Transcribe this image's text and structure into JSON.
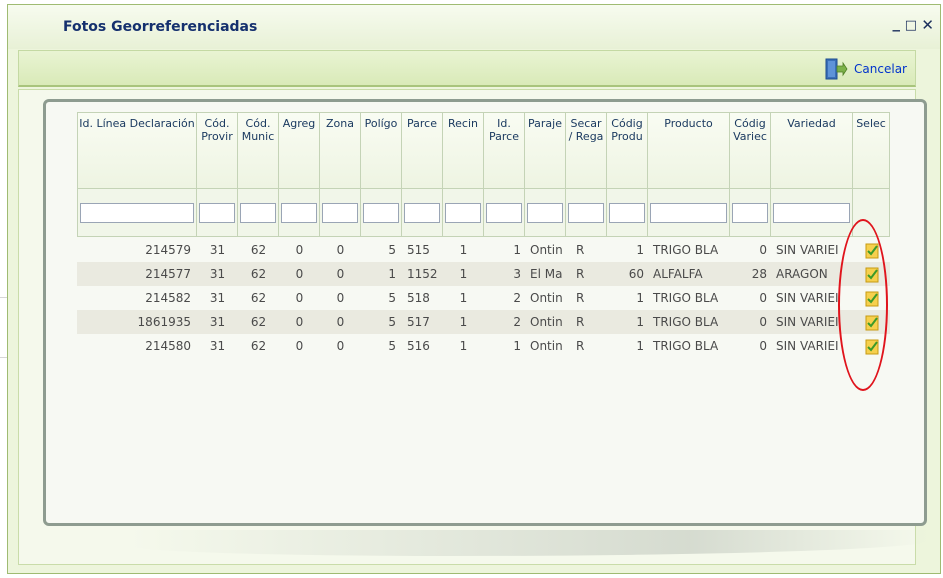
{
  "window": {
    "title": "Fotos Georreferenciadas",
    "minimize_symbol": "_",
    "maximize_symbol": "□",
    "close_symbol": "✕"
  },
  "toolbar": {
    "cancel_label": "Cancelar",
    "cancel_icon": "exit-door-icon"
  },
  "grid": {
    "columns": [
      {
        "label": "Id. Línea Declaración"
      },
      {
        "label": "Cód. Provir"
      },
      {
        "label": "Cód. Munic"
      },
      {
        "label": "Agreg"
      },
      {
        "label": "Zona"
      },
      {
        "label": "Polígo"
      },
      {
        "label": "Parce"
      },
      {
        "label": "Recin"
      },
      {
        "label": "Id. Parce"
      },
      {
        "label": "Paraje"
      },
      {
        "label": "Secar / Rega"
      },
      {
        "label": "Códig Produ"
      },
      {
        "label": "Producto"
      },
      {
        "label": "Códig Variec"
      },
      {
        "label": "Variedad"
      },
      {
        "label": "Selec"
      }
    ],
    "rows": [
      {
        "cells": [
          "214579",
          "31",
          "62",
          "0",
          "0",
          "5",
          "515",
          "1",
          "1",
          "Ontin",
          "R",
          "1",
          "TRIGO BLA",
          "0",
          "SIN VARIEI"
        ]
      },
      {
        "cells": [
          "214577",
          "31",
          "62",
          "0",
          "0",
          "1",
          "1152",
          "1",
          "3",
          "El Ma",
          "R",
          "60",
          "ALFALFA",
          "28",
          "ARAGON"
        ]
      },
      {
        "cells": [
          "214582",
          "31",
          "62",
          "0",
          "0",
          "5",
          "518",
          "1",
          "2",
          "Ontin",
          "R",
          "1",
          "TRIGO BLA",
          "0",
          "SIN VARIEI"
        ]
      },
      {
        "cells": [
          "1861935",
          "31",
          "62",
          "0",
          "0",
          "5",
          "517",
          "1",
          "2",
          "Ontin",
          "R",
          "1",
          "TRIGO BLA",
          "0",
          "SIN VARIEI"
        ]
      },
      {
        "cells": [
          "214580",
          "31",
          "62",
          "0",
          "0",
          "5",
          "516",
          "1",
          "1",
          "Ontin",
          "R",
          "1",
          "TRIGO BLA",
          "0",
          "SIN VARIEI"
        ]
      }
    ],
    "select_icon": "checklist-icon"
  },
  "colors": {
    "title_text": "#15306e",
    "link": "#0033cc",
    "highlight_ring": "#e0141c",
    "alt_row": "#eaeae0"
  }
}
